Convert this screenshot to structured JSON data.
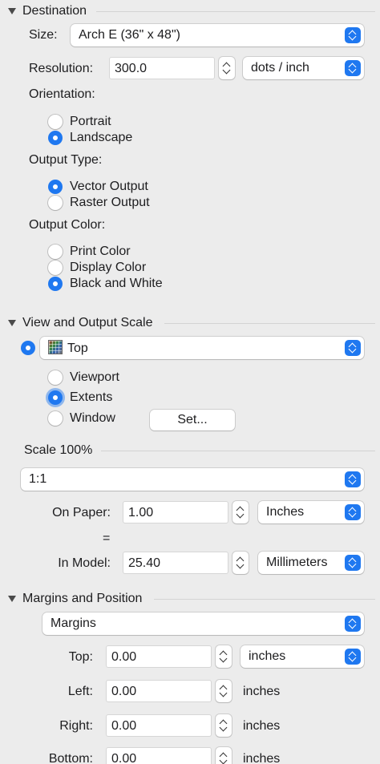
{
  "destination": {
    "header": "Destination",
    "size_label": "Size:",
    "size_value": "Arch E (36\" x 48\")",
    "resolution_label": "Resolution:",
    "resolution_value": "300.0",
    "resolution_unit": "dots / inch",
    "orientation_label": "Orientation:",
    "orientation_options": [
      "Portrait",
      "Landscape"
    ],
    "orientation_selected": "Landscape",
    "output_type_label": "Output Type:",
    "output_type_options": [
      "Vector Output",
      "Raster Output"
    ],
    "output_type_selected": "Vector Output",
    "output_color_label": "Output Color:",
    "output_color_options": [
      "Print Color",
      "Display Color",
      "Black and White"
    ],
    "output_color_selected": "Black and White"
  },
  "view_scale": {
    "header": "View and Output Scale",
    "view_value": "Top",
    "view_selected": true,
    "extent_options": [
      "Viewport",
      "Extents",
      "Window"
    ],
    "extent_selected": "Extents",
    "set_button": "Set...",
    "scale_header": "Scale 100%",
    "scale_value": "1:1",
    "on_paper_label": "On Paper:",
    "on_paper_value": "1.00",
    "on_paper_unit": "Inches",
    "equals": "=",
    "in_model_label": "In Model:",
    "in_model_value": "25.40",
    "in_model_unit": "Millimeters"
  },
  "margins": {
    "header": "Margins and Position",
    "mode_value": "Margins",
    "top_label": "Top:",
    "top_value": "0.00",
    "top_unit": "inches",
    "left_label": "Left:",
    "left_value": "0.00",
    "left_unit": "inches",
    "right_label": "Right:",
    "right_value": "0.00",
    "right_unit": "inches",
    "bottom_label": "Bottom:",
    "bottom_value": "0.00",
    "bottom_unit": "inches"
  },
  "colors": {
    "accent": "#1f78f0",
    "background": "#ececec"
  }
}
